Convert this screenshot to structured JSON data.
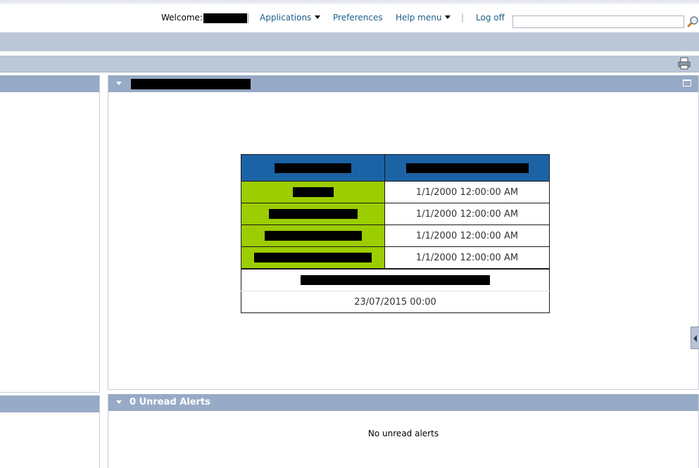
{
  "header": {
    "welcome_label": "Welcome:",
    "nav": {
      "applications": "Applications",
      "preferences": "Preferences",
      "help_menu": "Help menu",
      "separator": "|",
      "log_off": "Log off"
    },
    "search": {
      "value": "",
      "placeholder": ""
    },
    "icons": {
      "search": "magnifier-icon",
      "print": "printer-icon"
    }
  },
  "main_panel": {
    "icons": {
      "collapse": "triangle-down-icon",
      "maximize": "maximize-icon"
    },
    "table": {
      "rows": [
        {
          "time": "1/1/2000 12:00:00 AM"
        },
        {
          "time": "1/1/2000 12:00:00 AM"
        },
        {
          "time": "1/1/2000 12:00:00 AM"
        },
        {
          "time": "1/1/2000 12:00:00 AM"
        }
      ],
      "footer_date": "23/07/2015 00:00"
    }
  },
  "alerts_panel": {
    "title": "0 Unread Alerts",
    "empty_message": "No unread alerts"
  },
  "colors": {
    "panel_header": "#97aac6",
    "band": "#bcc7d8",
    "table_header": "#1c63a6",
    "status_green": "#9ccd00",
    "link": "#1a5e8a"
  }
}
